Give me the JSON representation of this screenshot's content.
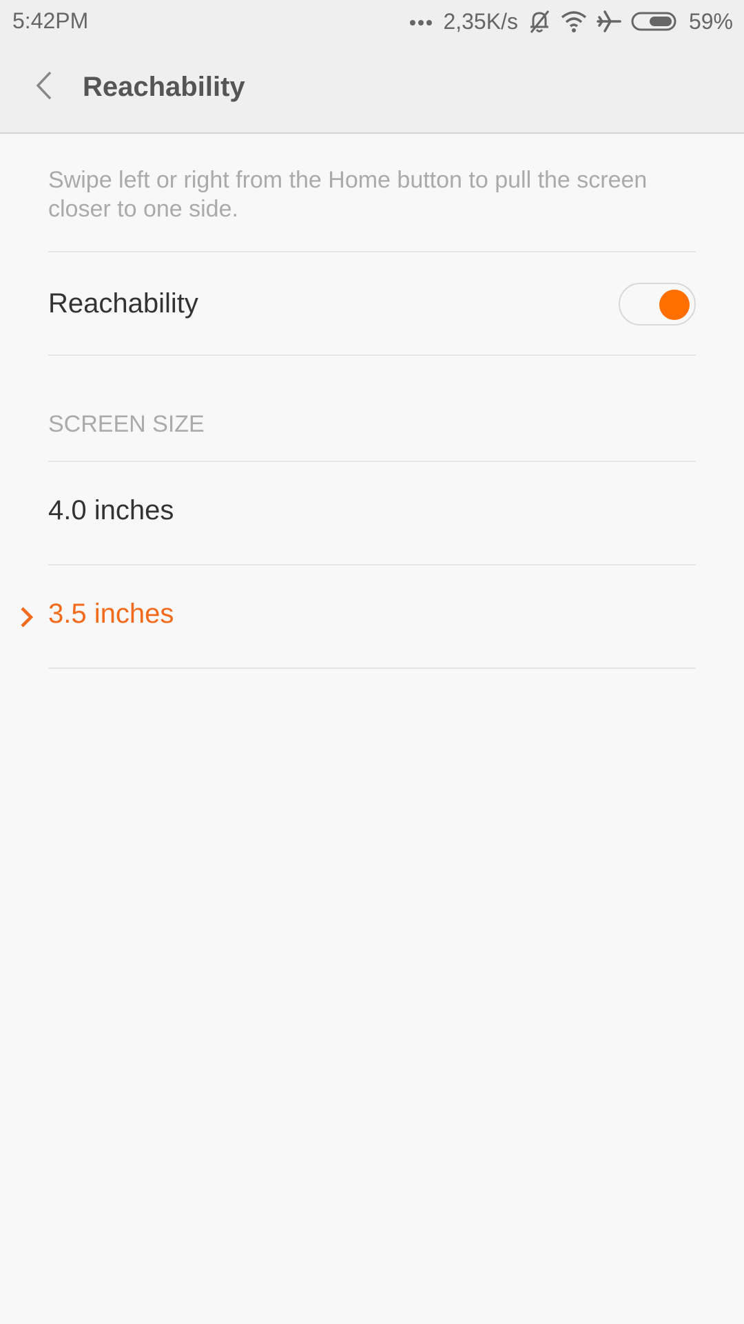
{
  "status_bar": {
    "time": "5:42PM",
    "network_speed": "2,35K/s",
    "battery_percent": "59%",
    "battery_level": 0.59,
    "icons": [
      "more-dots-icon",
      "bell-muted-icon",
      "wifi-icon",
      "airplane-icon",
      "battery-icon"
    ]
  },
  "app_bar": {
    "title": "Reachability",
    "back_icon": "chevron-left-icon"
  },
  "description": "Swipe left or right from the Home button to pull the screen closer to one side.",
  "reachability": {
    "label": "Reachability",
    "enabled": true
  },
  "screen_size": {
    "header": "SCREEN SIZE",
    "options": [
      {
        "label": "4.0 inches",
        "selected": false
      },
      {
        "label": "3.5 inches",
        "selected": true
      }
    ],
    "selected_icon": "chevron-right-icon"
  },
  "colors": {
    "accent": "#f26a1b",
    "toggle_knob": "#ff6f00",
    "text_primary": "#333333",
    "text_secondary": "#aaaaaa"
  }
}
